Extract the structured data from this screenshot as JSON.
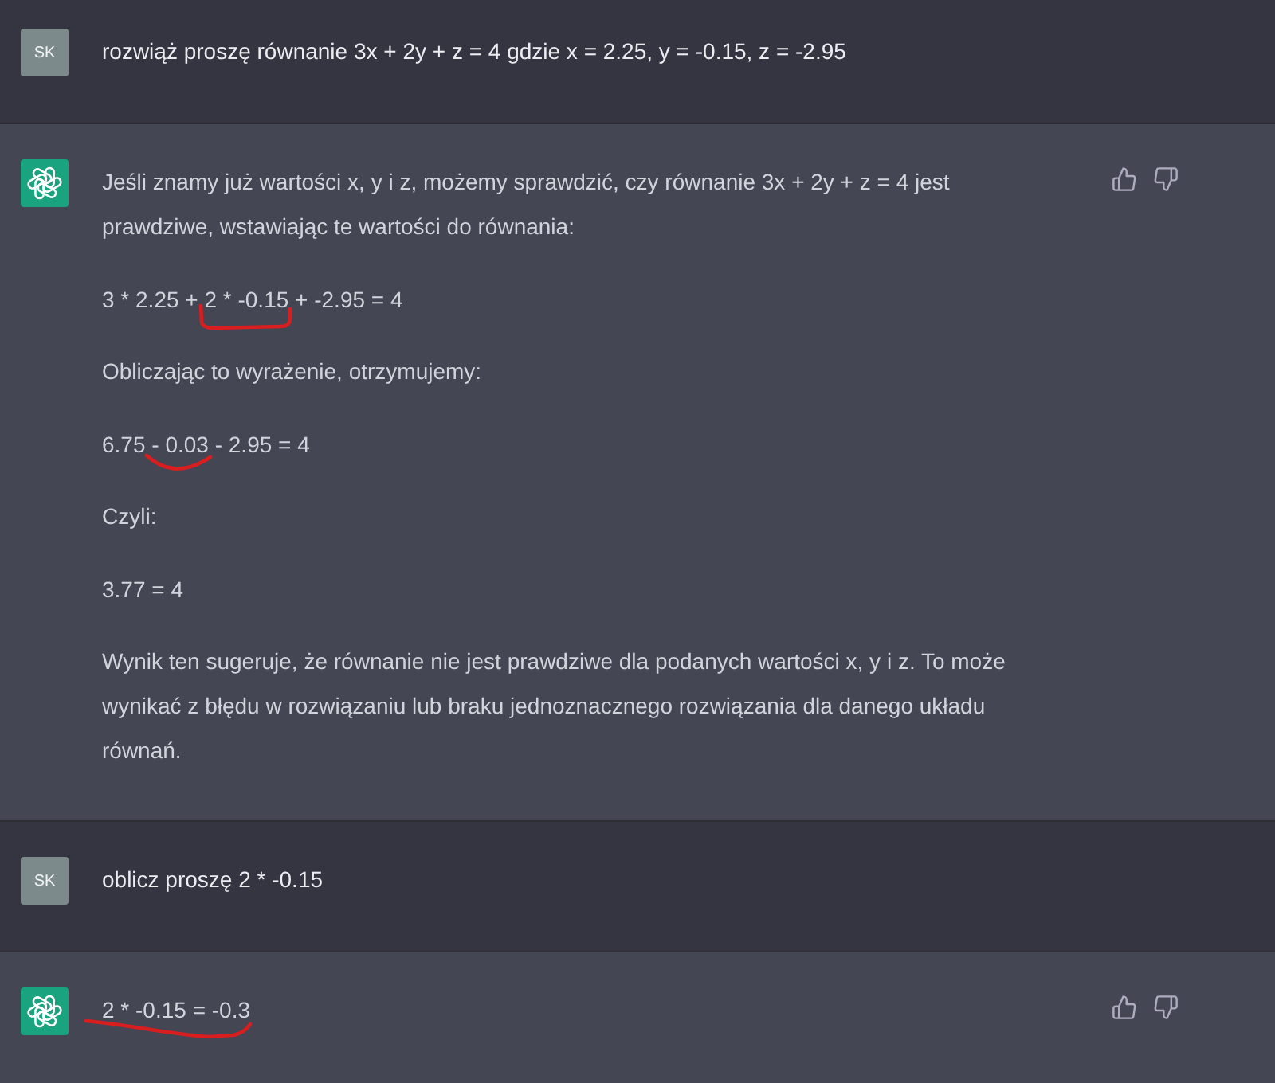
{
  "messages": [
    {
      "kind": "user",
      "avatar": "SK",
      "paragraphs": [
        {
          "parts": [
            {
              "kind": "plain",
              "text": "rozwiąż proszę równanie 3x + 2y + z = 4 gdzie x = 2.25, y = -0.15, z = -2.95"
            }
          ]
        }
      ]
    },
    {
      "kind": "assistant",
      "paragraphs": [
        {
          "parts": [
            {
              "kind": "plain",
              "text": "Jeśli znamy już wartości x, y i z, możemy sprawdzić, czy równanie 3x + 2y + z = 4 jest prawdziwe, wstawiając te wartości do równania:"
            }
          ]
        },
        {
          "parts": [
            {
              "kind": "plain",
              "text": "3 * 2.25 + "
            },
            {
              "kind": "bracket",
              "text": "2 * -0.15"
            },
            {
              "kind": "plain",
              "text": " + -2.95 = 4"
            }
          ]
        },
        {
          "parts": [
            {
              "kind": "plain",
              "text": "Obliczając to wyrażenie, otrzymujemy:"
            }
          ]
        },
        {
          "parts": [
            {
              "kind": "plain",
              "text": "6.75"
            },
            {
              "kind": "arc",
              "text": " - 0.03"
            },
            {
              "kind": "plain",
              "text": " - 2.95 = 4"
            }
          ]
        },
        {
          "parts": [
            {
              "kind": "plain",
              "text": "Czyli:"
            }
          ]
        },
        {
          "parts": [
            {
              "kind": "plain",
              "text": "3.77 = 4"
            }
          ]
        },
        {
          "parts": [
            {
              "kind": "plain",
              "text": "Wynik ten sugeruje, że równanie nie jest prawdziwe dla podanych wartości x, y i z. To może wynikać z błędu w rozwiązaniu lub braku jednoznacznego rozwiązania dla danego układu równań."
            }
          ]
        }
      ]
    },
    {
      "kind": "user",
      "avatar": "SK",
      "paragraphs": [
        {
          "parts": [
            {
              "kind": "plain",
              "text": "oblicz proszę 2 * -0.15"
            }
          ]
        }
      ]
    },
    {
      "kind": "assistant",
      "paragraphs": [
        {
          "parts": [
            {
              "kind": "underline",
              "text": "2 * -0.15 = -0.3"
            }
          ]
        }
      ]
    }
  ]
}
